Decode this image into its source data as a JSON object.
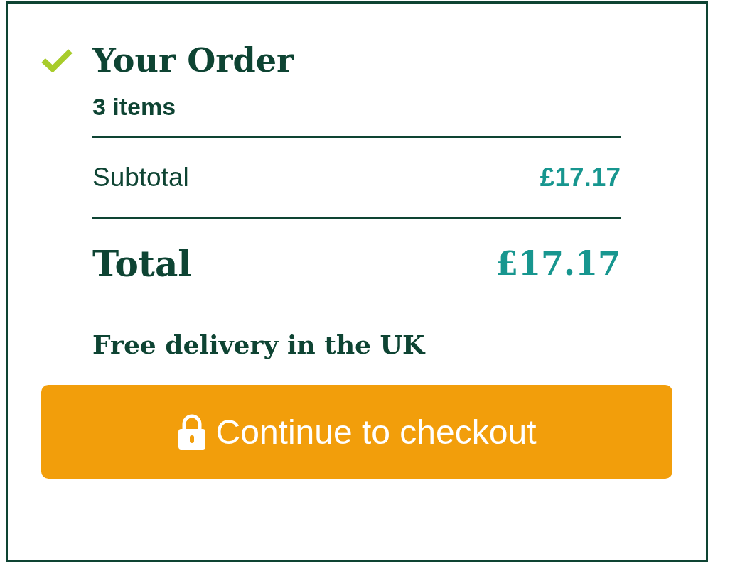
{
  "order": {
    "title": "Your Order",
    "item_count": "3 items",
    "rows": [
      {
        "kind": "subtotal",
        "label": "Subtotal",
        "value": "£17.17"
      },
      {
        "kind": "total",
        "label": "Total",
        "value": "£17.17"
      }
    ],
    "note": "Free delivery in the UK",
    "button": {
      "label": "Continue to checkout"
    }
  }
}
